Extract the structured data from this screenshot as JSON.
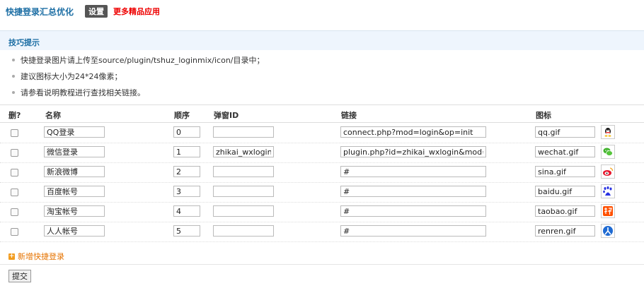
{
  "header": {
    "title": "快捷登录汇总优化",
    "settings_label": "设置",
    "more_label": "更多精品应用"
  },
  "tips": {
    "title": "技巧提示",
    "items": [
      "快捷登录图片请上传至source/plugin/tshuz_loginmix/icon/目录中；",
      "建议图标大小为24*24像素；",
      "请参看说明教程进行查找相关链接。"
    ]
  },
  "table": {
    "headers": {
      "delete": "删?",
      "name": "名称",
      "order": "顺序",
      "popup": "弹窗ID",
      "link": "链接",
      "icon": "图标"
    },
    "rows": [
      {
        "name": "QQ登录",
        "order": "0",
        "popup": "",
        "link": "connect.php?mod=login&op=init",
        "icon": "qq.gif",
        "icon_name": "qq-icon"
      },
      {
        "name": "微信登录",
        "order": "1",
        "popup": "zhikai_wxlogin",
        "link": "plugin.php?id=zhikai_wxlogin&mod=qrc",
        "icon": "wechat.gif",
        "icon_name": "wechat-icon"
      },
      {
        "name": "新浪微博",
        "order": "2",
        "popup": "",
        "link": "#",
        "icon": "sina.gif",
        "icon_name": "weibo-icon"
      },
      {
        "name": "百度帐号",
        "order": "3",
        "popup": "",
        "link": "#",
        "icon": "baidu.gif",
        "icon_name": "baidu-icon"
      },
      {
        "name": "淘宝帐号",
        "order": "4",
        "popup": "",
        "link": "#",
        "icon": "taobao.gif",
        "icon_name": "taobao-icon"
      },
      {
        "name": "人人帐号",
        "order": "5",
        "popup": "",
        "link": "#",
        "icon": "renren.gif",
        "icon_name": "renren-icon"
      }
    ]
  },
  "add_label": "新增快捷登录",
  "submit_label": "提交",
  "colors": {
    "accent": "#1c6ea4",
    "more_link": "#ee0000",
    "add_link": "#e67300",
    "tips_bg": "#eef5fd"
  }
}
